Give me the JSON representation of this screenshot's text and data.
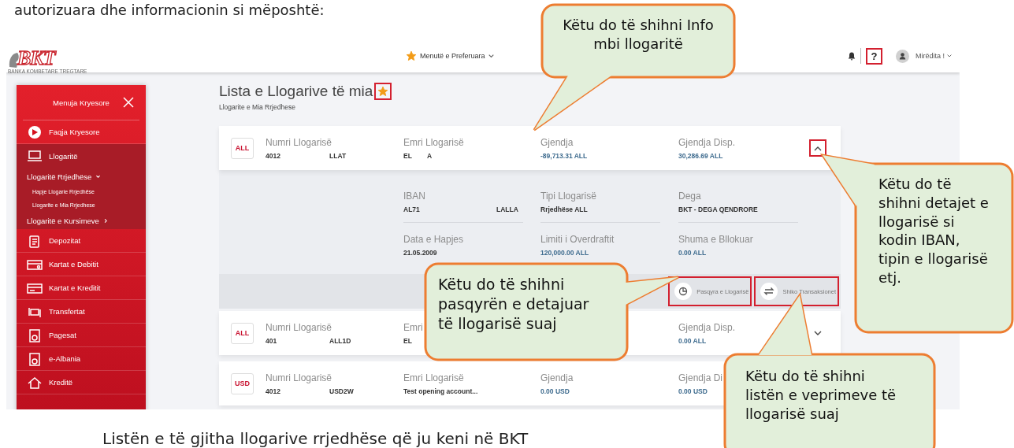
{
  "intro_text": "autorizuara dhe informacionin si mëposhtë:",
  "header": {
    "logo": "BKT",
    "logo_subtitle": "BANKA KOMBETARE TREGTARE",
    "favorites": "Menutë e Preferuara",
    "help": {
      "label": "?",
      "highlighted": true
    },
    "greeting": "Mirëdita !"
  },
  "sidebar": {
    "title": "Menuja Kryesore",
    "items": [
      {
        "kind": "main",
        "label": "Faqja Kryesore",
        "selected": false
      },
      {
        "kind": "main",
        "label": "Llogaritë",
        "selected": true
      },
      {
        "kind": "group",
        "label": "Llogaritë Rrjedhëse",
        "expanded": true,
        "children": [
          {
            "label": "Hapje Llogarie Rrjedhëse"
          },
          {
            "label": "Llogarite e Mia Rrjedhese"
          }
        ]
      },
      {
        "kind": "group",
        "label": "Llogaritë e Kursimeve",
        "expanded": false
      },
      {
        "kind": "main",
        "label": "Depozitat",
        "selected": false
      },
      {
        "kind": "main",
        "label": "Kartat e Debitit",
        "selected": false
      },
      {
        "kind": "main",
        "label": "Kartat e Kreditit",
        "selected": false
      },
      {
        "kind": "main",
        "label": "Transfertat",
        "selected": false
      },
      {
        "kind": "main",
        "label": "Pagesat",
        "selected": false
      },
      {
        "kind": "main",
        "label": "e-Albania",
        "selected": false
      },
      {
        "kind": "main",
        "label": "Kreditë",
        "selected": false
      }
    ]
  },
  "page": {
    "title": "Lista e Llogarive të mia",
    "favorite": {
      "on": true,
      "highlighted": true
    },
    "subtitle": "Llogarite e Mia Rrjedhese"
  },
  "accounts": [
    {
      "currency": "ALL",
      "expanded": true,
      "toggle_highlighted": true,
      "fields": [
        {
          "kind": "number",
          "label": "Numri Llogarisë",
          "value": [
            "4012",
            "LLAT"
          ]
        },
        {
          "kind": "name",
          "label": "Emri Llogarisë",
          "value": [
            "EL",
            "A"
          ]
        },
        {
          "kind": "balance",
          "label": "Gjendja",
          "value": [
            "-89,713.31 ALL"
          ]
        },
        {
          "kind": "available",
          "label": "Gjendja Disp.",
          "value": [
            "30,286.69 ALL"
          ]
        }
      ],
      "details": [
        {
          "kind": "iban",
          "label": "IBAN",
          "value": [
            "AL71",
            "LALLA"
          ]
        },
        {
          "kind": "type",
          "label": "Tipi Llogarisë",
          "value": [
            "Rrjedhëse ALL"
          ]
        },
        {
          "kind": "branch",
          "label": "Dega",
          "value": [
            "BKT - DEGA QENDRORE"
          ]
        },
        {
          "kind": "opened",
          "label": "Data e Hapjes",
          "value": [
            "21.05.2009"
          ]
        },
        {
          "kind": "overdraft",
          "label": "Limiti i Overdraftit",
          "value": [
            "120,000.00 ALL"
          ]
        },
        {
          "kind": "blocked",
          "label": "Shuma e Bllokuar",
          "value": [
            "0.00 ALL"
          ]
        }
      ],
      "actions": [
        {
          "kind": "statement",
          "label": "Pasqyra e Llogarisë",
          "highlighted": true
        },
        {
          "kind": "transactions",
          "label": "Shiko Transaksionet",
          "highlighted": true
        }
      ]
    },
    {
      "currency": "ALL",
      "expanded": false,
      "toggle_highlighted": false,
      "fields": [
        {
          "kind": "number",
          "label": "Numri Llogarisë",
          "value": [
            "401",
            "ALL1D"
          ]
        },
        {
          "kind": "name",
          "label": "Emri",
          "value": [
            "EL"
          ]
        },
        {
          "kind": "available",
          "label": "Gjendja Disp.",
          "value": [
            "0.00 ALL"
          ]
        }
      ]
    },
    {
      "currency": "USD",
      "fields": [
        {
          "kind": "number",
          "label": "Numri Llogarisë",
          "value": [
            "4012",
            "USD2W"
          ]
        },
        {
          "kind": "name",
          "label": "Emri Llogarisë",
          "value": [
            "Test opening account..."
          ]
        },
        {
          "kind": "balance",
          "label": "Gjendja",
          "value": [
            "0.00 USD"
          ]
        },
        {
          "kind": "available",
          "label": "Gjendja Di",
          "value": [
            "0.00 USD"
          ]
        }
      ]
    }
  ],
  "callouts": [
    {
      "text": "Këtu do të shihni Info mbi llogaritë"
    },
    {
      "text": "Këtu do të shihni detajet e llogarisë si kodin IBAN, tipin e llogarisë etj."
    },
    {
      "text": "Këtu do të shihni pasqyrën e detajuar të llogarisë suaj"
    },
    {
      "text": "Këtu do të shihni listën e veprimeve të llogarisë suaj"
    }
  ],
  "outro_text": "Listën e të gjitha llogarive rrjedhëse që ju keni në BKT"
}
